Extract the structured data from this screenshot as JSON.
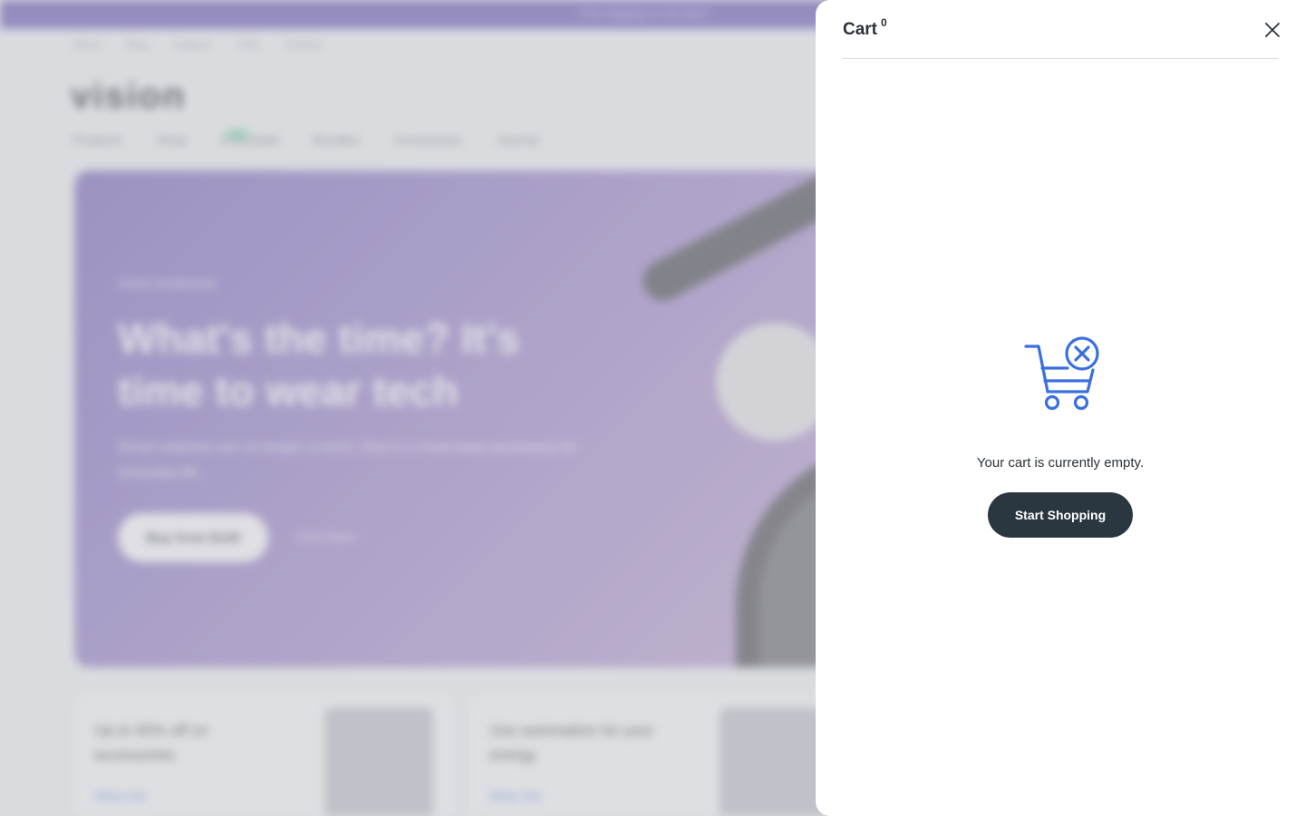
{
  "background": {
    "announcement": "Free shipping on all orders",
    "top_links": [
      "About",
      "Blog",
      "Support",
      "FAQ",
      "Contact"
    ],
    "logo": "vision",
    "nav": [
      "Products",
      "Shop",
      "Essentials",
      "Bundles",
      "Accessories",
      "Journal"
    ],
    "nav_badge": "New",
    "hero": {
      "eyebrow": "Smart wristbands",
      "title": "What's the time? It's time to wear tech",
      "subtitle": "Smart watches are no longer a trend, they're a must-have accessory for everyday life.",
      "cta_label": "Buy from $149",
      "link_label": "Find Store"
    },
    "cards": [
      {
        "title": "Up to 50% off on accessories",
        "link": "Shop now"
      },
      {
        "title": "Use automation for your energy",
        "link": "Shop now"
      }
    ]
  },
  "cart": {
    "title": "Cart",
    "count": "0",
    "empty_message": "Your cart is currently empty.",
    "cta_label": "Start Shopping",
    "icon": "empty-cart-icon",
    "accent_color": "#3b6fe0",
    "button_color": "#2b3740"
  }
}
